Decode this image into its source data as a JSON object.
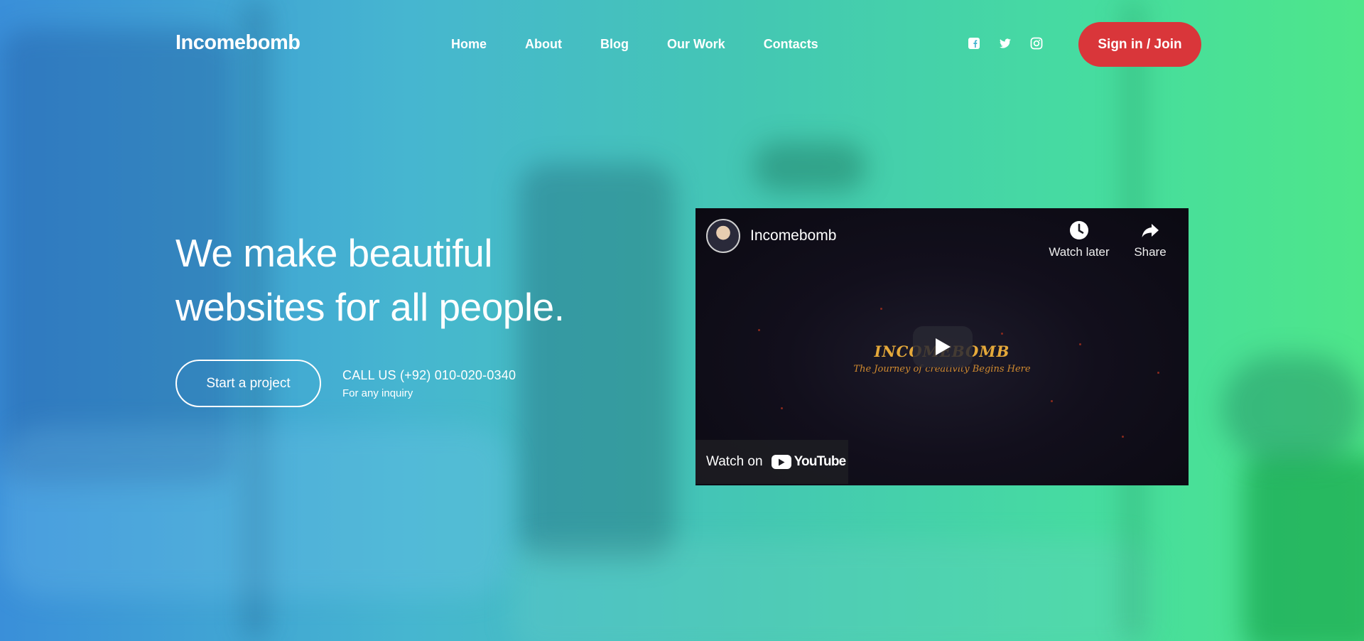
{
  "brand": {
    "logo": "Incomebomb"
  },
  "nav": {
    "items": [
      {
        "label": "Home"
      },
      {
        "label": "About"
      },
      {
        "label": "Blog"
      },
      {
        "label": "Our Work"
      },
      {
        "label": "Contacts"
      }
    ]
  },
  "social": {
    "icons": [
      "facebook-icon",
      "twitter-icon",
      "instagram-icon"
    ]
  },
  "header": {
    "signin_label": "Sign in / Join"
  },
  "hero": {
    "title_line1": "We make beautiful",
    "title_line2": "websites for all people.",
    "cta_label": "Start a project",
    "phone": "CALL US (+92) 010-020-0340",
    "phone_sub": "For any inquiry"
  },
  "video": {
    "channel_name": "Incomebomb",
    "watch_later_label": "Watch later",
    "share_label": "Share",
    "brand_text": "INCOMEBOMB",
    "tagline": "The Journey of creativity Begins Here",
    "watch_on_label": "Watch on",
    "youtube_label": "YouTube"
  },
  "colors": {
    "accent": "#d9363a",
    "gradient_start": "#3a8fd9",
    "gradient_end": "#4ee68a"
  }
}
